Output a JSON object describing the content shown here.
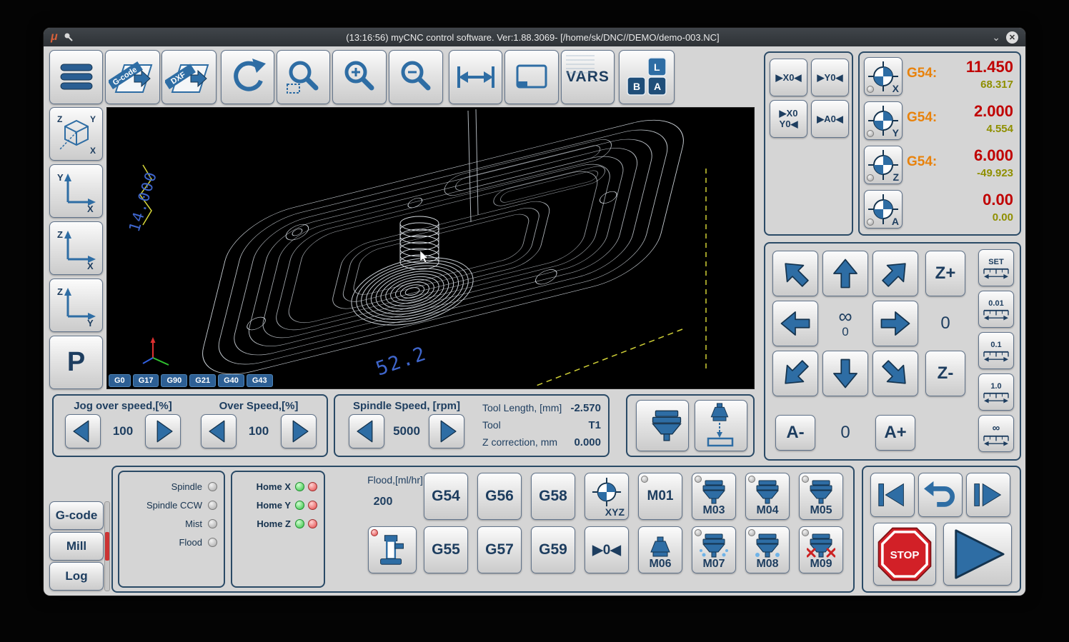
{
  "window": {
    "logo": "μ",
    "title": "(13:16:56) myCNC control software. Ver:1.88.3069- [/home/sk/DNC//DEMO/demo-003.NC]",
    "chevron": "⌄",
    "close": "✕"
  },
  "toolbar": {
    "gcode_file": "G-code",
    "dxf_file": "DXF",
    "vars": "VARS",
    "key_l": "L",
    "key_b": "B",
    "key_a": "A"
  },
  "sidebar": {
    "view3d_letters": [
      "Z",
      "Y",
      "X"
    ],
    "view_yx": [
      "Y",
      "X"
    ],
    "view_zx": [
      "Z",
      "X"
    ],
    "view_zy": [
      "Z",
      "Y"
    ],
    "p": "P"
  },
  "viewport": {
    "dim_left": "14.000",
    "dim_bottom": "52.2",
    "gcodes": [
      "G0",
      "G17",
      "G90",
      "G21",
      "G40",
      "G43"
    ]
  },
  "zero": {
    "x0": "▶X0◀",
    "y0": "▶Y0◀",
    "x0y0_top": "▶X0",
    "x0y0_bottom": "Y0◀",
    "a0": "▶A0◀"
  },
  "dro": {
    "rows": [
      {
        "axis": "X",
        "wcs": "G54:",
        "value": "11.450",
        "machine": "68.317"
      },
      {
        "axis": "Y",
        "wcs": "G54:",
        "value": "2.000",
        "machine": "4.554"
      },
      {
        "axis": "Z",
        "wcs": "G54:",
        "value": "6.000",
        "machine": "-49.923"
      },
      {
        "axis": "A",
        "wcs": "",
        "value": "0.00",
        "machine": "0.00"
      }
    ]
  },
  "jog": {
    "z_plus": "Z+",
    "z_minus": "Z-",
    "a_minus": "A-",
    "a_plus": "A+",
    "infinity": "∞",
    "zero_under_infinity": "0",
    "xy_step_value": "0",
    "a_value": "0",
    "steps": [
      "SET",
      "0.01",
      "0.1",
      "1.0",
      "∞"
    ]
  },
  "speed": {
    "jog_over_label": "Jog over speed,[%]",
    "jog_over_value": "100",
    "over_label": "Over Speed,[%]",
    "over_value": "100",
    "spindle_label": "Spindle Speed, [rpm]",
    "spindle_value": "5000",
    "tool_length_label": "Tool Length, [mm]",
    "tool_length_value": "-2.570",
    "tool_label": "Tool",
    "tool_value": "T1",
    "z_corr_label": "Z correction, mm",
    "z_corr_value": "0.000"
  },
  "tabs": [
    {
      "label": "G-code"
    },
    {
      "label": "Mill"
    },
    {
      "label": "Log"
    }
  ],
  "status": {
    "led_off": "gray",
    "coolant_led": "red",
    "outputs": [
      {
        "label": "Spindle"
      },
      {
        "label": "Spindle CCW"
      },
      {
        "label": "Mist"
      },
      {
        "label": "Flood"
      }
    ],
    "homes": [
      {
        "label": "Home X",
        "led1": "green",
        "led2": "red"
      },
      {
        "label": "Home Y",
        "led1": "green",
        "led2": "red"
      },
      {
        "label": "Home Z",
        "led1": "green",
        "led2": "red"
      }
    ],
    "flood_label": "Flood,[ml/hr]",
    "flood_value": "200"
  },
  "gbuttons": {
    "g54": "G54",
    "g55": "G55",
    "g56": "G56",
    "g57": "G57",
    "g58": "G58",
    "g59": "G59",
    "xyz": "XYZ",
    "goto_zero": "▶0◀",
    "m01": "M01",
    "m03": "M03",
    "m04": "M04",
    "m05": "M05",
    "m06": "M06",
    "m07": "M07",
    "m08": "M08",
    "m09": "M09"
  },
  "transport": {
    "stop": "STOP"
  },
  "colors": {
    "accent_blue": "#2e6da4",
    "navy": "#1d3d5f",
    "dro_wcs_orange": "#e8820c",
    "dro_value_red": "#c00000",
    "dro_machine_olive": "#8f8f00"
  }
}
